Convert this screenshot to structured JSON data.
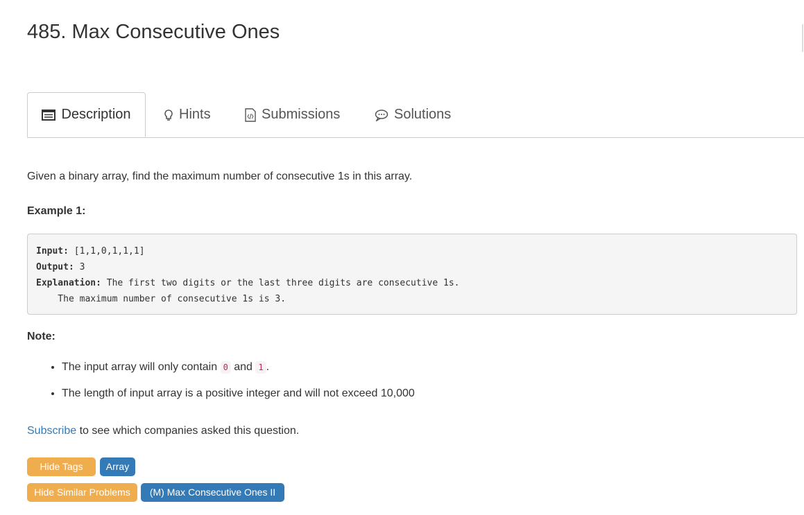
{
  "title": "485. Max Consecutive Ones",
  "tabs": [
    {
      "label": "Description",
      "icon": "list-icon"
    },
    {
      "label": "Hints",
      "icon": "lightbulb-icon"
    },
    {
      "label": "Submissions",
      "icon": "code-file-icon"
    },
    {
      "label": "Solutions",
      "icon": "chat-bubble-icon"
    }
  ],
  "description": "Given a binary array, find the maximum number of consecutive 1s in this array.",
  "example_heading": "Example 1:",
  "example": {
    "input_label": "Input:",
    "input_value": " [1,1,0,1,1,1]",
    "output_label": "Output:",
    "output_value": " 3",
    "explanation_label": "Explanation:",
    "explanation_value": " The first two digits or the last three digits are consecutive 1s.",
    "explanation_cont": "    The maximum number of consecutive 1s is 3."
  },
  "note_heading": "Note:",
  "notes": {
    "n1_pre": "The input array will only contain ",
    "n1_code1": "0",
    "n1_mid": " and ",
    "n1_code2": "1",
    "n1_post": ".",
    "n2": "The length of input array is a positive integer and will not exceed 10,000"
  },
  "subscribe_link": "Subscribe",
  "subscribe_text": " to see which companies asked this question.",
  "hide_tags": "Hide Tags",
  "tag": "Array",
  "hide_similar": "Hide Similar Problems",
  "similar": "(M) Max Consecutive Ones II",
  "colors": {
    "orange": "#f0ad4e",
    "blue": "#337ab7",
    "link": "#337ab7"
  }
}
